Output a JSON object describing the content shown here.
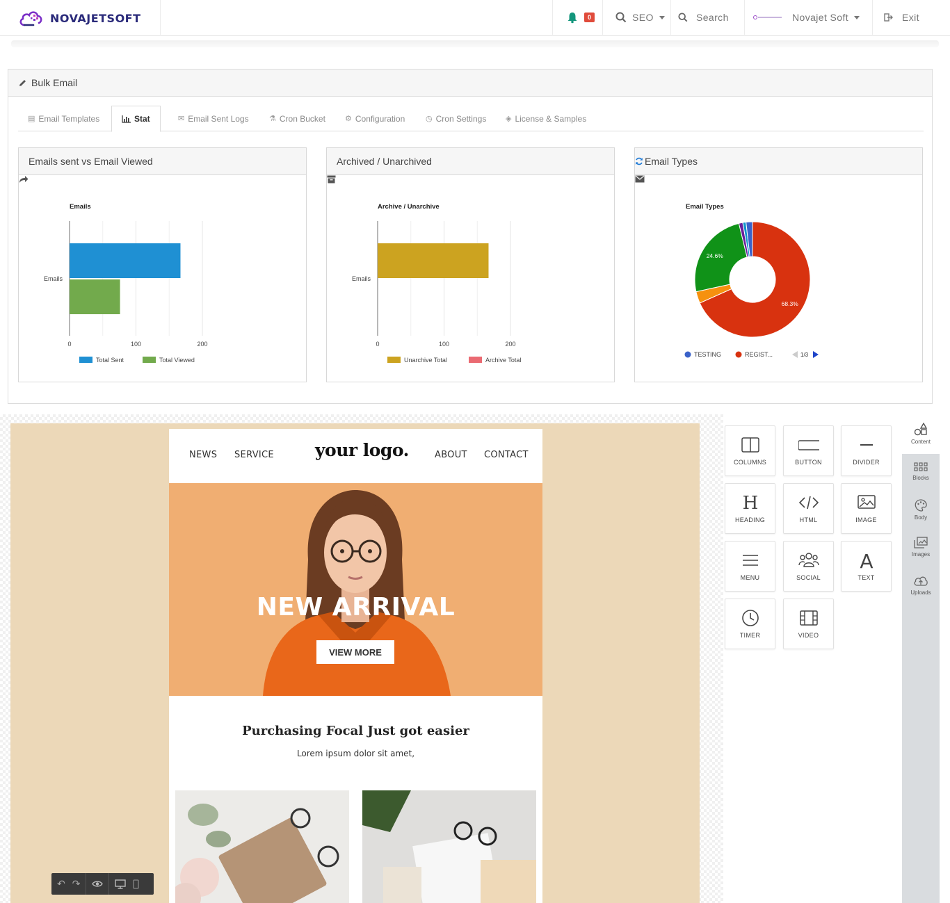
{
  "nav": {
    "brand": "NOVAJETSOFT",
    "notification_count": "0",
    "seo_label": "SEO",
    "search_label": "Search",
    "user_name": "Novajet Soft",
    "exit_label": "Exit"
  },
  "panel": {
    "title": "Bulk Email",
    "tabs": [
      {
        "label": "Email Templates",
        "icon": "list-icon"
      },
      {
        "label": "Stat",
        "icon": "bar-chart-icon",
        "active": true
      },
      {
        "label": "Email Sent Logs",
        "icon": "envelope-icon"
      },
      {
        "label": "Cron Bucket",
        "icon": "flask-icon"
      },
      {
        "label": "Configuration",
        "icon": "cogs-icon"
      },
      {
        "label": "Cron Settings",
        "icon": "clock-icon"
      },
      {
        "label": "License & Samples",
        "icon": "tag-icon"
      }
    ]
  },
  "cards": [
    {
      "title": "Emails sent vs Email Viewed",
      "icon": "share-icon"
    },
    {
      "title": "Archived / Unarchived",
      "icon": "archive-icon"
    },
    {
      "title": "Email Types",
      "icon": "envelope-icon",
      "action_icon": "refresh-icon"
    }
  ],
  "chart_data": [
    {
      "type": "bar",
      "title": "Emails",
      "categories": [
        "Emails"
      ],
      "series": [
        {
          "name": "Total Sent",
          "values": [
            167
          ],
          "color": "#1f90d3"
        },
        {
          "name": "Total Viewed",
          "values": [
            76
          ],
          "color": "#72aa4c"
        }
      ],
      "xlim": [
        0,
        200
      ],
      "ticks": [
        "0",
        "100",
        "200"
      ],
      "grid": true,
      "legend": "bottom"
    },
    {
      "type": "bar",
      "title": "Archive / Unarchive",
      "categories": [
        "Emails"
      ],
      "series": [
        {
          "name": "Unarchive Total",
          "values": [
            167
          ],
          "color": "#cca320"
        },
        {
          "name": "Archive Total",
          "values": [
            0
          ],
          "color": "#ea6a72"
        }
      ],
      "xlim": [
        0,
        200
      ],
      "ticks": [
        "0",
        "100",
        "200"
      ],
      "grid": true,
      "legend": "bottom"
    },
    {
      "type": "pie",
      "title": "Email Types",
      "donut": true,
      "slices": [
        {
          "name": "REGISTRATION",
          "value": 68.3,
          "label": "68.3%",
          "color": "#d8320f"
        },
        {
          "name": "",
          "value": 3.3,
          "color": "#f6910f"
        },
        {
          "name": "",
          "value": 24.6,
          "label": "24.6%",
          "color": "#109218"
        },
        {
          "name": "",
          "value": 1.1,
          "color": "#6a1e9a"
        },
        {
          "name": "",
          "value": 0.9,
          "color": "#0f94cc"
        },
        {
          "name": "TESTING",
          "value": 1.8,
          "color": "#3a62c9"
        }
      ],
      "legend": [
        {
          "label": "TESTING",
          "color": "#3a62c9"
        },
        {
          "label": "REGIST...",
          "color": "#d8320f"
        }
      ],
      "legend_page": "1/3"
    }
  ],
  "email": {
    "nav_left": [
      "NEWS",
      "SERVICE"
    ],
    "logo": "your logo.",
    "nav_right": [
      "ABOUT",
      "CONTACT"
    ],
    "hero_title": "NEW ARRIVAL",
    "hero_button": "VIEW MORE",
    "headline": "Purchasing Focal Just got easier",
    "subline": "Lorem ipsum dolor sit amet,"
  },
  "tools": [
    {
      "label": "COLUMNS",
      "icon": "columns-icon"
    },
    {
      "label": "BUTTON",
      "icon": "button-icon"
    },
    {
      "label": "DIVIDER",
      "icon": "divider-icon"
    },
    {
      "label": "HEADING",
      "icon": "heading-icon"
    },
    {
      "label": "HTML",
      "icon": "code-icon"
    },
    {
      "label": "IMAGE",
      "icon": "image-icon"
    },
    {
      "label": "MENU",
      "icon": "menu-icon"
    },
    {
      "label": "SOCIAL",
      "icon": "social-icon"
    },
    {
      "label": "TEXT",
      "icon": "text-icon"
    },
    {
      "label": "TIMER",
      "icon": "clock-icon"
    },
    {
      "label": "VIDEO",
      "icon": "video-icon"
    }
  ],
  "side_tabs": [
    {
      "label": "Content",
      "icon": "shapes-icon",
      "active": true
    },
    {
      "label": "Blocks",
      "icon": "grid-icon"
    },
    {
      "label": "Body",
      "icon": "palette-icon"
    },
    {
      "label": "Images",
      "icon": "images-icon"
    },
    {
      "label": "Uploads",
      "icon": "cloud-upload-icon"
    }
  ]
}
